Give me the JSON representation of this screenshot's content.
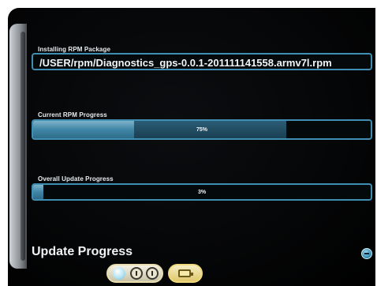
{
  "screen": {
    "title": "Update Progress"
  },
  "package": {
    "label": "Installing RPM Package",
    "path": "/USER/rpm/Diagnostics_gps-0.0.1-201111141558.armv7l.rpm"
  },
  "current_progress": {
    "label": "Current RPM Progress",
    "percent": 75,
    "text": "75%"
  },
  "overall_progress": {
    "label": "Overall Update Progress",
    "percent": 3,
    "text": "3%"
  },
  "icons": {
    "help": "help-icon",
    "nav_dots": [
      "active-dot-icon",
      "info-dot-icon",
      "alert-dot-icon"
    ],
    "battery": "battery-icon"
  },
  "colors": {
    "accent": "#3e8fb1",
    "progress_fill": "#3f86a6",
    "background": "#000000"
  }
}
